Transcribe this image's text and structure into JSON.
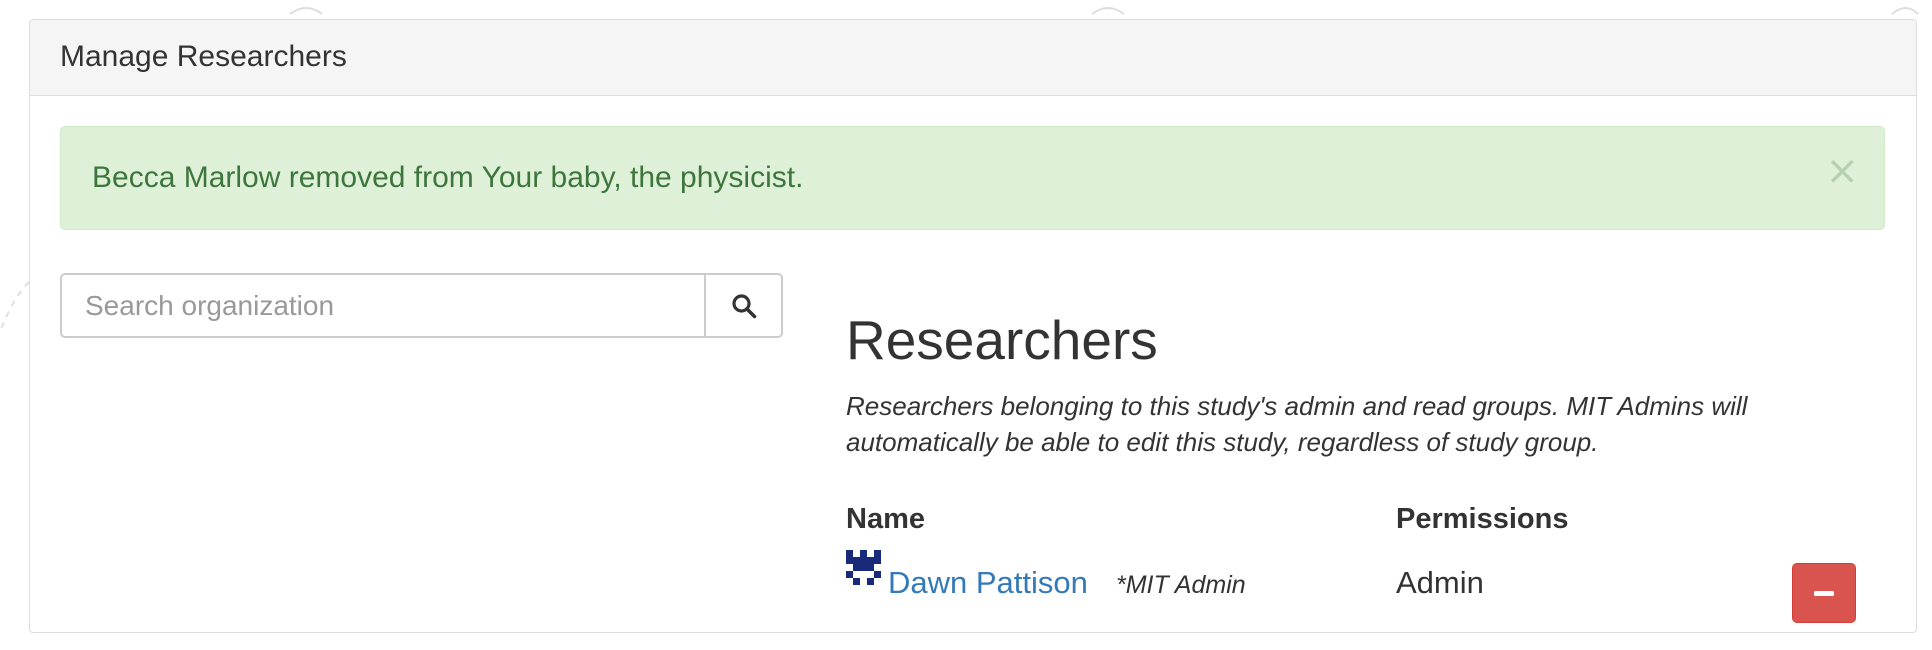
{
  "panel": {
    "title": "Manage Researchers"
  },
  "alert": {
    "message": "Becca Marlow removed from Your baby, the physicist.",
    "close_symbol": "×",
    "color": "#3c763d",
    "background": "#dff0d8"
  },
  "search": {
    "placeholder": "Search organization",
    "value": "",
    "icon": "search-icon"
  },
  "researchers": {
    "heading": "Researchers",
    "description": "Researchers belonging to this study's admin and read groups. MIT Admins will automatically be able to edit this study, regardless of study group.",
    "columns": {
      "name": "Name",
      "permissions": "Permissions"
    },
    "rows": [
      {
        "name": "Dawn Pattison",
        "role_note": "*MIT Admin",
        "permission": "Admin",
        "remove_icon": "minus-icon"
      }
    ]
  },
  "colors": {
    "link": "#337ab7",
    "danger": "#d9534f"
  }
}
